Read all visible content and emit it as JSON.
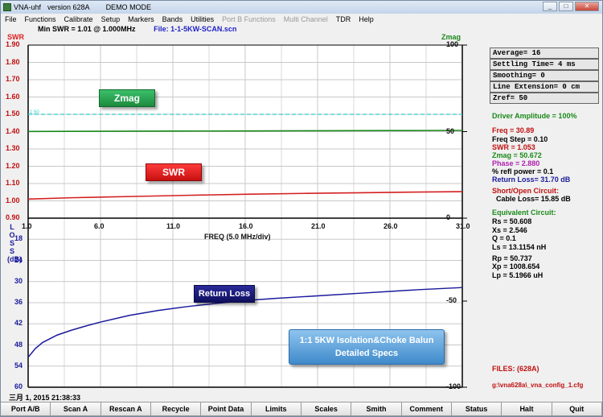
{
  "window": {
    "title": "VNA-uhf",
    "version": "version 628A",
    "mode": "DEMO MODE",
    "controls": {
      "minimize": "_",
      "restore": "□",
      "close": "✕"
    }
  },
  "menu": [
    "File",
    "Functions",
    "Calibrate",
    "Setup",
    "Markers",
    "Bands",
    "Utilities",
    "Port B Functions",
    "Multi Channel",
    "TDR",
    "Help"
  ],
  "menu_disabled": [
    "Port B Functions",
    "Multi Channel"
  ],
  "info": {
    "min_swr": "Min SWR =    1.01 @  1.000MHz",
    "file": "File: 1-1-5KW-SCAN.scn"
  },
  "chart_data": [
    {
      "type": "line",
      "title": "",
      "xlabel": "FREQ (5.0 MHz/div)",
      "x_ticks": [
        "1.0",
        "6.0",
        "11.0",
        "16.0",
        "21.0",
        "26.0",
        "31.0"
      ],
      "xlim": [
        1.0,
        31.0
      ],
      "left_axis": {
        "label": "SWR",
        "ticks": [
          "1.90",
          "1.80",
          "1.70",
          "1.60",
          "1.50",
          "1.40",
          "1.30",
          "1.20",
          "1.10",
          "1.00",
          "0.90"
        ],
        "ylim": [
          0.9,
          1.9
        ]
      },
      "right_axis": {
        "label": "Zmag",
        "ticks": [
          "100",
          "50",
          "0"
        ],
        "ylim": [
          0,
          100
        ]
      },
      "reference_line": {
        "label": "1.50",
        "value": 1.5,
        "color": "#33cccc"
      },
      "series": [
        {
          "name": "SWR",
          "color": "#d42020",
          "x": [
            1,
            4,
            8,
            12,
            16,
            20,
            24,
            28,
            31
          ],
          "y": [
            1.01,
            1.018,
            1.025,
            1.032,
            1.038,
            1.043,
            1.047,
            1.051,
            1.053
          ]
        },
        {
          "name": "Zmag",
          "color": "#1a8a1a",
          "x": [
            1,
            6,
            11,
            16,
            21,
            26,
            31
          ],
          "y": [
            50.1,
            50.2,
            50.3,
            50.4,
            50.5,
            50.6,
            50.7
          ]
        }
      ],
      "grid": true
    },
    {
      "type": "line",
      "title": "",
      "left_axis": {
        "label": "LOSS (dB)",
        "ticks": [
          "18",
          "24",
          "30",
          "36",
          "42",
          "48",
          "54",
          "60"
        ],
        "ylim": [
          60,
          12
        ],
        "inverted": true
      },
      "right_axis": {
        "ticks": [
          "-50",
          "-100"
        ]
      },
      "series": [
        {
          "name": "Return Loss",
          "color": "#1a1a9c",
          "x": [
            1,
            1.5,
            2,
            3,
            4,
            5,
            6,
            8,
            10,
            12,
            14,
            16,
            18,
            20,
            22,
            24,
            26,
            28,
            30,
            31
          ],
          "y": [
            51.5,
            49.0,
            47.3,
            45.2,
            43.8,
            42.6,
            41.5,
            39.6,
            38.2,
            37.1,
            36.2,
            35.4,
            34.8,
            34.3,
            33.8,
            33.3,
            32.8,
            32.3,
            31.9,
            31.7
          ]
        }
      ],
      "grid": true
    }
  ],
  "callouts": {
    "zmag": "Zmag",
    "swr": "SWR",
    "return_loss": "Return Loss",
    "balun_line1": "1:1 5KW Isolation&Choke Balun",
    "balun_line2": "Detailed Specs"
  },
  "settings": {
    "average": "Average= 16",
    "settling": "Settling Time= 4 ms",
    "smoothing": "Smoothing= 0",
    "line_ext": "Line Extension= 0 cm",
    "zref": "Zref= 50"
  },
  "readouts": {
    "driver_amp": "Driver Amplitude = 100%",
    "freq": "Freq = 30.89",
    "freq_step": "Freq Step = 0.10",
    "swr": "SWR =   1.053",
    "zmag": "Zmag =   50.672",
    "phase": "Phase =     2.880",
    "refl_power": "% refl power =  0.1",
    "return_loss": "Return Loss= 31.70 dB",
    "short_open": "Short/Open Circuit:",
    "cable_loss": "Cable Loss= 15.85 dB",
    "equiv": "Equivalent Circuit:",
    "rs": "Rs =   50.608",
    "xs": "Xs =    2.546",
    "q": "Q =   0.1",
    "ls": "Ls =    13.1154  nH",
    "rp": "Rp =   50.737",
    "xp": "Xp = 1008.654",
    "lp": "Lp =    5.1966  uH",
    "files": "FILES: (628A)",
    "config": "g:\\vna628a\\_vna_config_1.cfg"
  },
  "datetime": "三月 1, 2015  21:38:33",
  "toolbar": [
    "Port A/B",
    "Scan A",
    "Rescan A",
    "Recycle",
    "Point Data",
    "Limits",
    "Scales",
    "Smith",
    "Comment",
    "Status",
    "Halt",
    "Quit"
  ],
  "colors": {
    "swr": "#d42020",
    "zmag": "#1a8a1a",
    "loss": "#1a1a9c",
    "ref": "#33cccc"
  }
}
